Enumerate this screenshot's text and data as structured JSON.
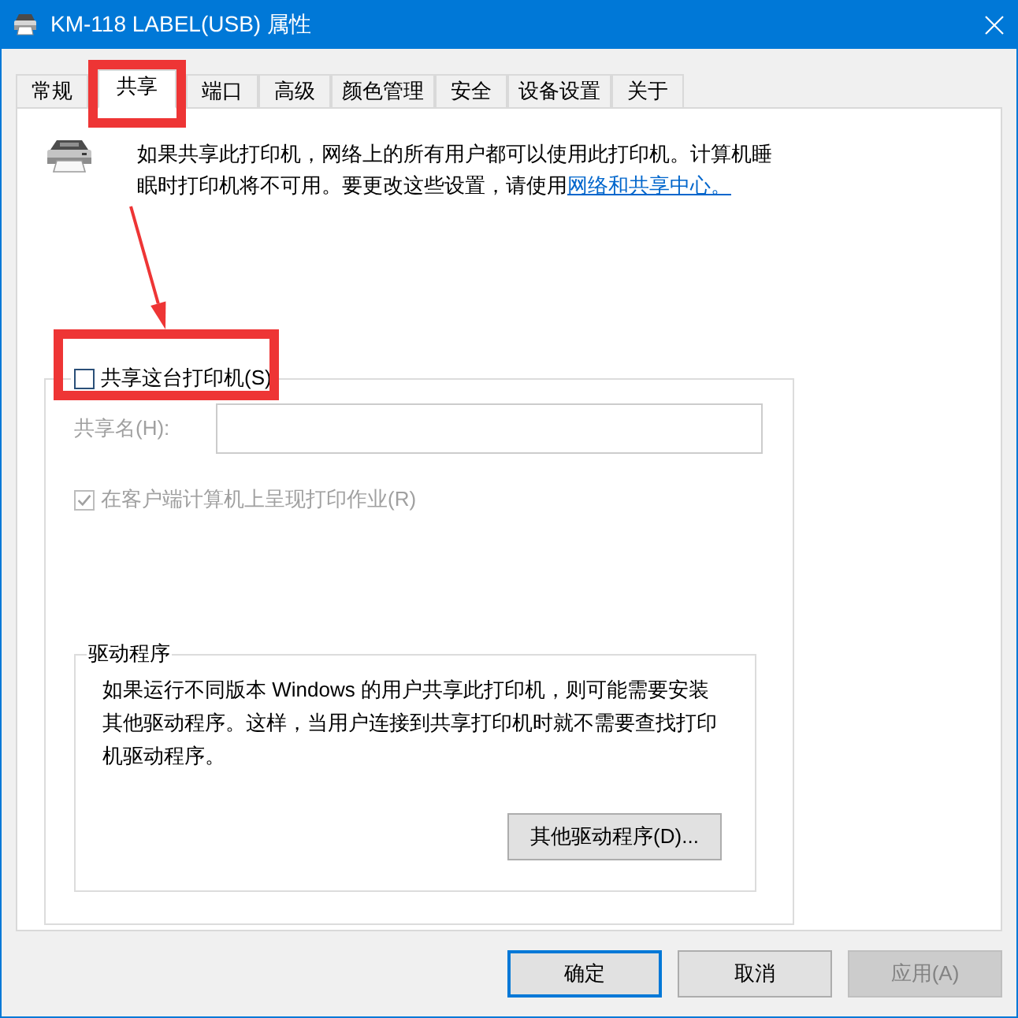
{
  "window": {
    "title": "KM-118 LABEL(USB) 属性"
  },
  "tabs": [
    {
      "label": "常规",
      "selected": false,
      "highlighted": false
    },
    {
      "label": "共享",
      "selected": true,
      "highlighted": true
    },
    {
      "label": "端口",
      "selected": false,
      "highlighted": false
    },
    {
      "label": "高级",
      "selected": false,
      "highlighted": false
    },
    {
      "label": "颜色管理",
      "selected": false,
      "highlighted": false
    },
    {
      "label": "安全",
      "selected": false,
      "highlighted": false
    },
    {
      "label": "设备设置",
      "selected": false,
      "highlighted": false
    },
    {
      "label": "关于",
      "selected": false,
      "highlighted": false
    }
  ],
  "sharing": {
    "intro": {
      "text": "如果共享此打印机，网络上的所有用户都可以使用此打印机。计算机睡眠时打印机将不可用。要更改这些设置，请使用",
      "link": "网络和共享中心。"
    },
    "share_printer": {
      "label": "共享这台打印机(S)",
      "checked": false,
      "highlighted": true
    },
    "share_name": {
      "label": "共享名(H):",
      "disabled": true
    },
    "render_on_client": {
      "label": "在客户端计算机上呈现打印作业(R)",
      "checked": true,
      "disabled": true
    },
    "drivers": {
      "title": "驱动程序",
      "text": "如果运行不同版本 Windows 的用户共享此打印机，则可能需要安装其他驱动程序。这样，当用户连接到共享打印机时就不需要查找打印机驱动程序。",
      "button": "其他驱动程序(D)..."
    }
  },
  "annotation": {
    "arrow": true
  },
  "buttons": [
    {
      "label": "确定",
      "default": true,
      "disabled": false
    },
    {
      "label": "取消",
      "default": false,
      "disabled": false
    },
    {
      "label": "应用(A)",
      "default": false,
      "disabled": true
    }
  ]
}
